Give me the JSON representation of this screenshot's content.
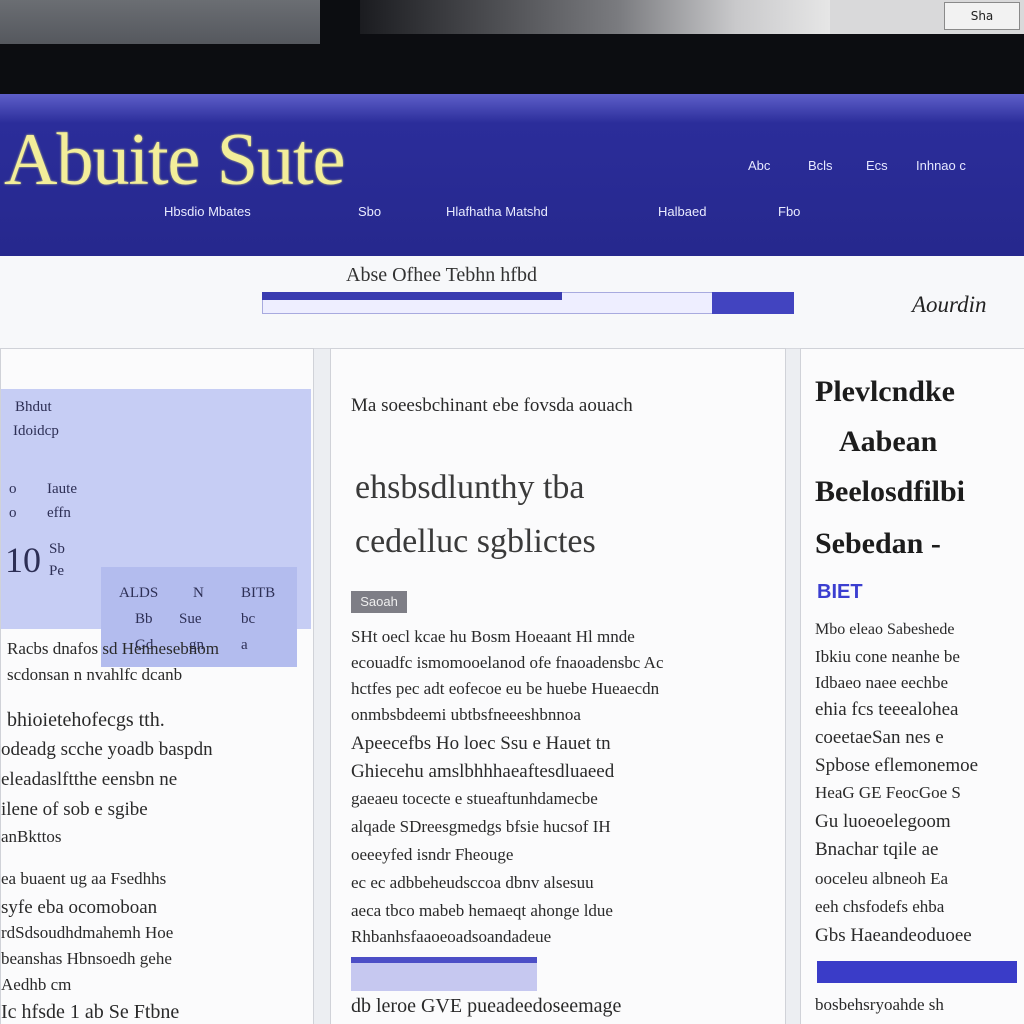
{
  "photo_tag": "Sha",
  "site": {
    "logo": "Abuite Sute"
  },
  "top_nav": [
    "Abc",
    "Bcls",
    "Ecs",
    "Inhnao c"
  ],
  "sub_nav": [
    "Hbsdio Mbates",
    "Sbo",
    "Hlafhatha Matshd",
    "Halbaed",
    "Fbo"
  ],
  "search": {
    "label": "Abse Ofhee Tebhn hfbd"
  },
  "sidebar_heading": "Aourdin",
  "left_column": {
    "info_box": {
      "cells": [
        "Bhdut",
        "Idoidcp",
        "o",
        "Iaute",
        "o",
        "effn",
        "10",
        "Sb",
        "Pe",
        "ALDS",
        "N",
        "BITB",
        "Bb",
        "Sue",
        "bc",
        "Gd",
        "gn",
        "a"
      ]
    },
    "paragraphs": [
      "Racbs dnafos sd Hennesebnom",
      "scdonsan n nvahlfc dcanb",
      "bhioietehofecgs tth.",
      "odeadg scche yoadb baspdn",
      "eleadaslftthe eensbn ne",
      "ilene of sob e sgibe",
      "anBkttos",
      "ea buaent ug aa Fsedhhs",
      "syfe eba ocomoboan",
      "rdSdsoudhdmahemh Hoe",
      "beanshas Hbnsoedh gehe",
      "Aedhb cm",
      "Ic hfsde 1 ab Se Ftbne"
    ]
  },
  "middle_column": {
    "intro": "Ma soeesbchinant ebe fovsda aouach",
    "headline": [
      "ehsbsdlunthy tba",
      "cedelluc sgblictes"
    ],
    "section_tag": "Saoah",
    "paragraphs": [
      "SHt oecl kcae hu Bosm Hoeaant Hl mnde",
      "ecouadfc ismomooelanod ofe fnaoadensbc Ac",
      "hctfes pec adt eofecoe eu be huebe Hueaecdn",
      "onmbsbdeemi ubtbsfneeeshbnnoa",
      "Apeecefbs Ho loec Ssu e Hauet tn",
      "Ghiecehu amslbhhhaeaftesdluaeed",
      "gaeaeu tocecte e stueaftunhdamecbe",
      "alqade SDreesgmedgs bfsie hucsof IH",
      "oeeeyfed isndr Fheouge",
      "ec ec adbbeheudsccoa dbnv alsesuu",
      "aeca tbco mabeb hemaeqt ahonge ldue",
      "Rhbanhsfaaoeoadsoandadeue",
      "db leroe GVE pueadeedoseemage"
    ]
  },
  "right_column": {
    "title": [
      "Plevlcndke",
      "Aabean",
      "Beelosdfilbi",
      "Sebedan -"
    ],
    "badge": "BIET",
    "paragraphs": [
      "Mbo eleao Sabeshede",
      "Ibkiu cone neanhe be",
      "Idbaeo naee eechbe",
      "ehia fcs teeealohea",
      "coeetaeSan nes e",
      "Spbose eflemonemoe",
      "HeaG GE FeocGoe S",
      "Gu luoeoelegoom",
      "Bnachar tqile ae",
      "ooceleu albneoh Ea",
      "eeh chsfodefs ehba",
      "Gbs Haeandeoduoee",
      "bosbehsryoahde sh"
    ]
  }
}
